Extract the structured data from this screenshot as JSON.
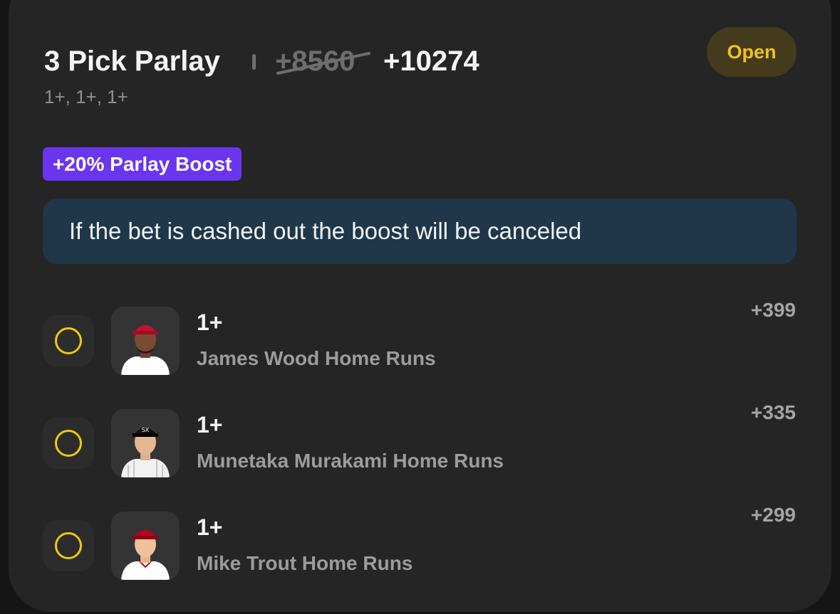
{
  "parlay": {
    "title": "3 Pick Parlay",
    "original_odds": "+8560",
    "boosted_odds": "+10274",
    "lines_summary": "1+, 1+, 1+",
    "status": "Open",
    "boost_label": "+20% Parlay Boost",
    "notice": "If the bet is cashed out the boost will be canceled"
  },
  "legs": [
    {
      "line": "1+",
      "market": "James Wood Home Runs",
      "odds": "+399",
      "cap_color": "#c8102e",
      "jersey_color": "#ffffff"
    },
    {
      "line": "1+",
      "market": "Munetaka Murakami Home Runs",
      "odds": "+335",
      "cap_color": "#111111",
      "jersey_color": "#f1f1f1"
    },
    {
      "line": "1+",
      "market": "Mike Trout Home Runs",
      "odds": "+299",
      "cap_color": "#ba0021",
      "jersey_color": "#ffffff"
    }
  ],
  "colors": {
    "status_text": "#f1c21d",
    "boost_bg": "#6a35ef",
    "notice_bg": "#1f3748",
    "radio": "#f2c90a"
  }
}
